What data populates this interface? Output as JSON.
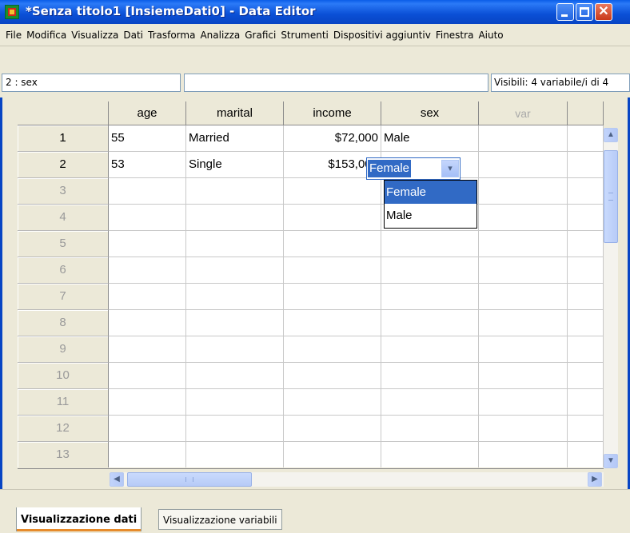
{
  "window": {
    "title": "*Senza titolo1 [InsiemeDati0] - Data Editor",
    "close_glyph": "✕"
  },
  "menu": [
    "File",
    "Modifica",
    "Visualizza",
    "Dati",
    "Trasforma",
    "Analizza",
    "Grafici",
    "Strumenti",
    "Dispositivi aggiuntiv",
    "Finestra",
    "Aiuto"
  ],
  "cell_editor": {
    "reference": "2 : sex",
    "value": "",
    "visible_vars": "Visibili: 4 variabile/i di 4"
  },
  "grid": {
    "columns": [
      "age",
      "marital",
      "income",
      "sex",
      "var"
    ],
    "row_numbers": [
      "1",
      "2",
      "3",
      "4",
      "5",
      "6",
      "7",
      "8",
      "9",
      "10",
      "11",
      "12",
      "13"
    ],
    "rows": [
      [
        "55",
        "Married",
        "$72,000",
        "Male"
      ],
      [
        "53",
        "Single",
        "$153,000",
        ""
      ]
    ]
  },
  "active_editor": {
    "selected_value": "Female",
    "dropdown_arrow": "▾",
    "options": [
      "Female",
      "Male"
    ]
  },
  "scroll": {
    "up": "▲",
    "down": "▼",
    "left": "◀",
    "right": "▶"
  },
  "tabs": {
    "data_view": "Visualizzazione dati",
    "variable_view": "Visualizzazione variabili"
  },
  "colors": {
    "titlebar": "#0a4fd6",
    "selection": "#316ac5",
    "tab_accent": "#e68b2c"
  }
}
